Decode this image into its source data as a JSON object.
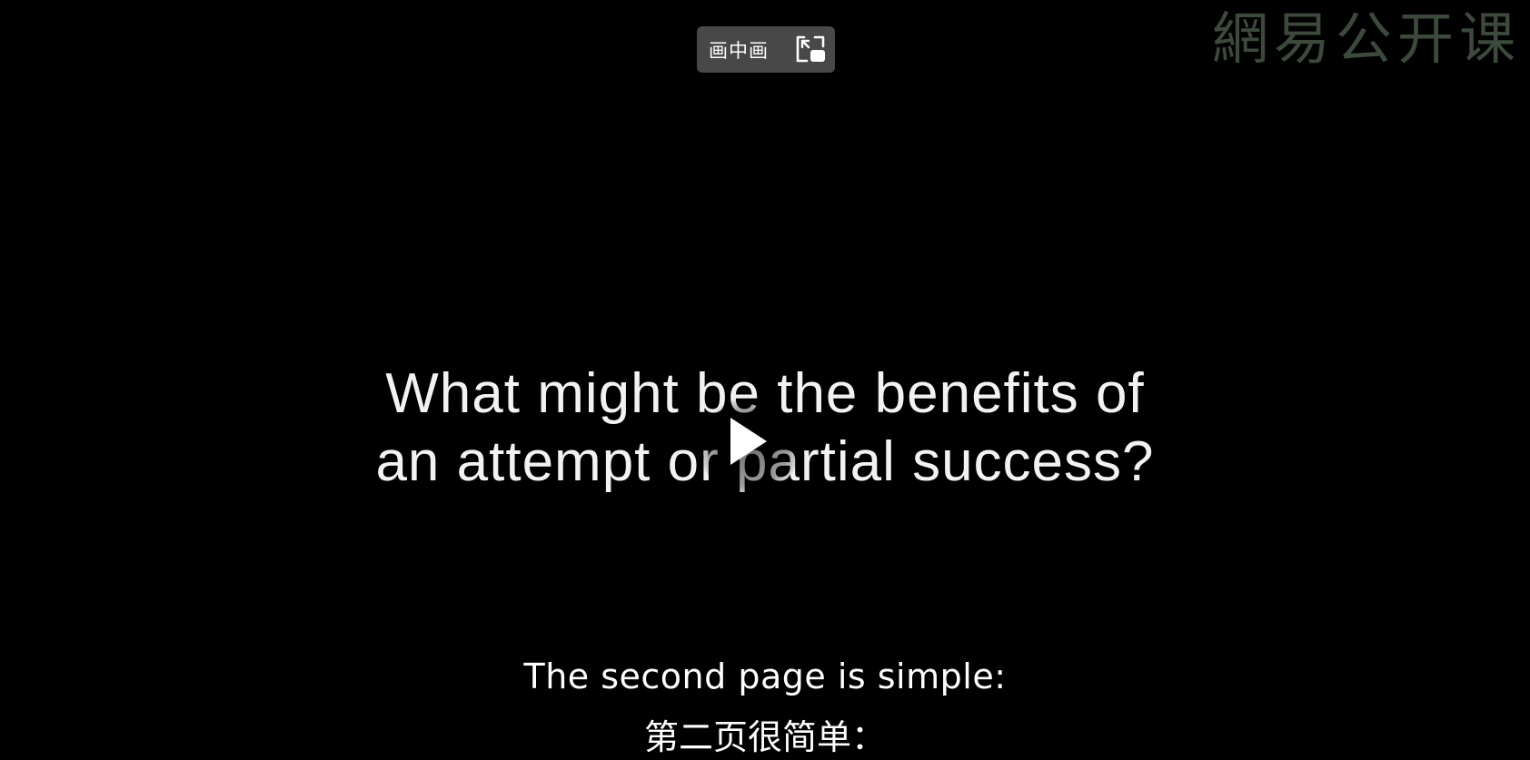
{
  "pip": {
    "label": "画中画",
    "icon": "picture-in-picture-icon"
  },
  "watermark": {
    "text": "網易公开课"
  },
  "slide": {
    "line1": "What might be the benefits of",
    "line2": "an attempt or partial success?"
  },
  "player": {
    "play_icon": "play-icon"
  },
  "subtitles": {
    "english": "The second page is simple:",
    "chinese": "第二页很简单："
  },
  "colors": {
    "background": "#000000",
    "text": "#ffffff",
    "pip_background": "#4e4e4e",
    "watermark": "#3b4a3b"
  }
}
